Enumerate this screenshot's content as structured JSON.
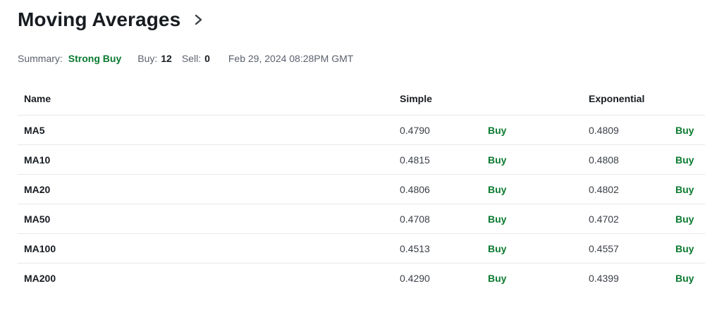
{
  "header": {
    "title": "Moving Averages"
  },
  "summary": {
    "label": "Summary:",
    "signal": "Strong Buy",
    "buy_label": "Buy:",
    "buy_count": "12",
    "sell_label": "Sell:",
    "sell_count": "0",
    "timestamp": "Feb 29, 2024 08:28PM GMT"
  },
  "colors": {
    "buy": "#0a7a2f",
    "title": "#181c21",
    "divider": "#e6e8eb"
  },
  "icons": {
    "header_link": "chevron-right-icon"
  },
  "table": {
    "columns": {
      "name": "Name",
      "simple": "Simple",
      "exponential": "Exponential"
    },
    "rows": [
      {
        "name": "MA5",
        "simple": "0.4790",
        "simple_action": "Buy",
        "exponential": "0.4809",
        "exponential_action": "Buy"
      },
      {
        "name": "MA10",
        "simple": "0.4815",
        "simple_action": "Buy",
        "exponential": "0.4808",
        "exponential_action": "Buy"
      },
      {
        "name": "MA20",
        "simple": "0.4806",
        "simple_action": "Buy",
        "exponential": "0.4802",
        "exponential_action": "Buy"
      },
      {
        "name": "MA50",
        "simple": "0.4708",
        "simple_action": "Buy",
        "exponential": "0.4702",
        "exponential_action": "Buy"
      },
      {
        "name": "MA100",
        "simple": "0.4513",
        "simple_action": "Buy",
        "exponential": "0.4557",
        "exponential_action": "Buy"
      },
      {
        "name": "MA200",
        "simple": "0.4290",
        "simple_action": "Buy",
        "exponential": "0.4399",
        "exponential_action": "Buy"
      }
    ]
  }
}
